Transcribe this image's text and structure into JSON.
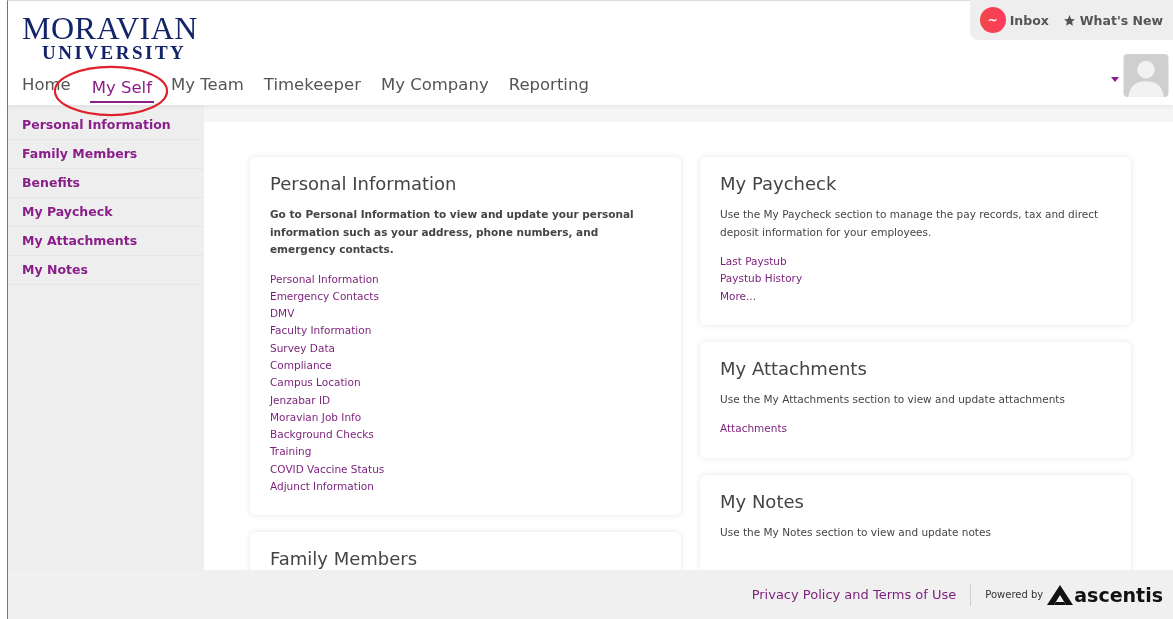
{
  "logo": {
    "line_1": "MORAVIAN",
    "line_2": "UNIVERSITY"
  },
  "top_bar": {
    "inbox": {
      "badge": "~",
      "label": "Inbox"
    },
    "whats_new": "What's New"
  },
  "nav": [
    {
      "label": "Home",
      "selected": false
    },
    {
      "label": "My Self",
      "selected": true
    },
    {
      "label": "My Team",
      "selected": false
    },
    {
      "label": "Timekeeper",
      "selected": false
    },
    {
      "label": "My Company",
      "selected": false
    },
    {
      "label": "Reporting",
      "selected": false
    }
  ],
  "sidebar": {
    "items": [
      "Personal Information",
      "Family Members",
      "Benefits",
      "My Paycheck",
      "My Attachments",
      "My Notes"
    ]
  },
  "columns": [
    {
      "cards": [
        {
          "title": "Personal Information",
          "description": "Go to Personal Information to view and update your personal information such as your address, phone numbers, and emergency contacts.",
          "bold_description": true,
          "links": [
            "Personal Information",
            "Emergency Contacts",
            "DMV",
            "Faculty Information",
            "Survey Data",
            "Compliance",
            "Campus Location",
            "Jenzabar ID",
            "Moravian Job Info",
            "Background Checks",
            "Training",
            "COVID Vaccine Status",
            "Adjunct Information"
          ]
        },
        {
          "title": "Family Members"
        }
      ]
    },
    {
      "cards": [
        {
          "title": "My Paycheck",
          "description": "Use the My Paycheck section to manage the pay records, tax and direct deposit information for your employees.",
          "bold_description": false,
          "links": [
            "Last Paystub",
            "Paystub History",
            "More..."
          ]
        },
        {
          "title": "My Attachments",
          "description": "Use the My Attachments section to view and update attachments",
          "bold_description": false,
          "links": [
            "Attachments"
          ]
        },
        {
          "title": "My Notes",
          "description": "Use the My Notes section to view and update notes",
          "bold_description": false
        }
      ]
    }
  ],
  "footer": {
    "link": "Privacy Policy and Terms of Use",
    "powered_by": "Powered by",
    "brand": "ascentis"
  }
}
